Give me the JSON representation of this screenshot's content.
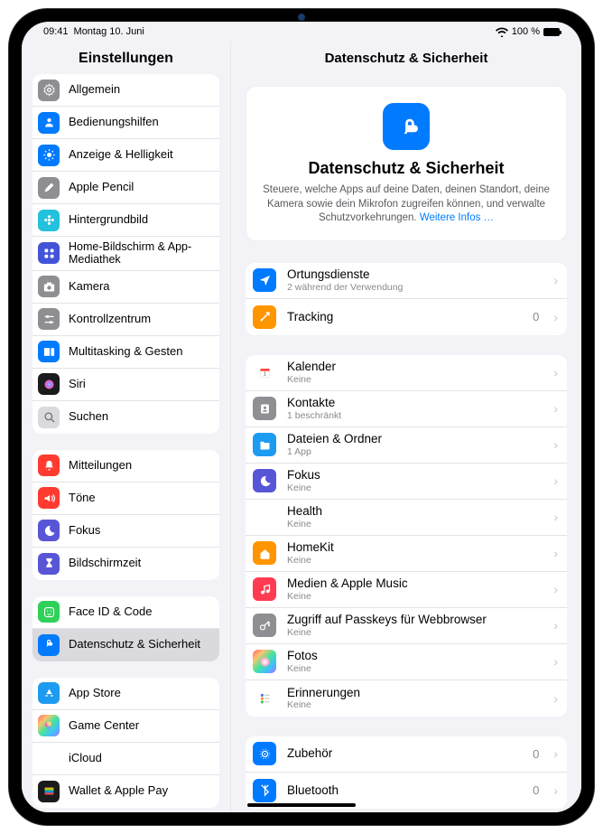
{
  "status": {
    "time": "09:41",
    "date": "Montag 10. Juni",
    "battery_text": "100 %"
  },
  "sidebar_title": "Einstellungen",
  "detail_title": "Datenschutz & Sicherheit",
  "hero": {
    "title": "Datenschutz & Sicherheit",
    "desc_prefix": "Steuere, welche Apps auf deine Daten, deinen Standort, deine Kamera sowie dein Mikrofon zugreifen können, und verwalte Schutzvorkehrungen. ",
    "link": "Weitere Infos …"
  },
  "sidebar_groups": [
    [
      {
        "id": "general",
        "label": "Allgemein",
        "icon": "gear",
        "bg": "#8e8e93"
      },
      {
        "id": "accessibility",
        "label": "Bedienungshilfen",
        "icon": "person",
        "bg": "#007aff"
      },
      {
        "id": "display",
        "label": "Anzeige & Helligkeit",
        "icon": "sun",
        "bg": "#007aff"
      },
      {
        "id": "pencil",
        "label": "Apple Pencil",
        "icon": "pencil",
        "bg": "#8e8e93"
      },
      {
        "id": "wallpaper",
        "label": "Hintergrundbild",
        "icon": "flower",
        "bg": "#23c1de"
      },
      {
        "id": "home",
        "label": "Home-Bildschirm & App-Mediathek",
        "icon": "grid",
        "bg": "#4353d8",
        "multiline": true
      },
      {
        "id": "camera",
        "label": "Kamera",
        "icon": "camera",
        "bg": "#8e8e93"
      },
      {
        "id": "control",
        "label": "Kontrollzentrum",
        "icon": "sliders",
        "bg": "#8e8e93"
      },
      {
        "id": "multitask",
        "label": "Multitasking & Gesten",
        "icon": "rects",
        "bg": "#007aff"
      },
      {
        "id": "siri",
        "label": "Siri",
        "icon": "siri",
        "bg": "#1b1b1d"
      },
      {
        "id": "search",
        "label": "Suchen",
        "icon": "search",
        "bg": "#d9d9de",
        "fg": "#6e6e73"
      }
    ],
    [
      {
        "id": "notifications",
        "label": "Mitteilungen",
        "icon": "bell",
        "bg": "#ff3b30"
      },
      {
        "id": "sounds",
        "label": "Töne",
        "icon": "speaker",
        "bg": "#ff3b30"
      },
      {
        "id": "focus",
        "label": "Fokus",
        "icon": "moon",
        "bg": "#5856d6"
      },
      {
        "id": "screentime",
        "label": "Bildschirmzeit",
        "icon": "hourglass",
        "bg": "#5856d6"
      }
    ],
    [
      {
        "id": "faceid",
        "label": "Face ID & Code",
        "icon": "face",
        "bg": "#30d158"
      },
      {
        "id": "privacy",
        "label": "Datenschutz & Sicherheit",
        "icon": "hand",
        "bg": "#007aff",
        "selected": true
      }
    ],
    [
      {
        "id": "appstore",
        "label": "App Store",
        "icon": "appstore",
        "bg": "#1d9bf0"
      },
      {
        "id": "gamecenter",
        "label": "Game Center",
        "icon": "gamecenter",
        "bg": "#ffffff",
        "grad": true
      },
      {
        "id": "icloud",
        "label": "iCloud",
        "icon": "cloud",
        "bg": "#ffffff",
        "fg": "#1fa8ff"
      },
      {
        "id": "wallet",
        "label": "Wallet & Apple Pay",
        "icon": "wallet",
        "bg": "#1b1b1d"
      }
    ]
  ],
  "detail_groups": [
    [
      {
        "id": "location",
        "label": "Ortungsdienste",
        "sub": "2 während der Verwendung",
        "icon": "location",
        "bg": "#007aff"
      },
      {
        "id": "tracking",
        "label": "Tracking",
        "value": "0",
        "icon": "tracking",
        "bg": "#ff9500"
      }
    ],
    [
      {
        "id": "calendar",
        "label": "Kalender",
        "sub": "Keine",
        "icon": "calendar",
        "bg": "#ffffff",
        "fg": "#ff3b30"
      },
      {
        "id": "contacts",
        "label": "Kontakte",
        "sub": "1 beschränkt",
        "icon": "contacts",
        "bg": "#8e8e93"
      },
      {
        "id": "files",
        "label": "Dateien & Ordner",
        "sub": "1 App",
        "icon": "folder",
        "bg": "#1d9bf0"
      },
      {
        "id": "focus2",
        "label": "Fokus",
        "sub": "Keine",
        "icon": "moon",
        "bg": "#5856d6"
      },
      {
        "id": "health",
        "label": "Health",
        "sub": "Keine",
        "icon": "heart",
        "bg": "#ffffff",
        "fg": "#ff3b5c"
      },
      {
        "id": "homekit",
        "label": "HomeKit",
        "sub": "Keine",
        "icon": "home",
        "bg": "#ff9500"
      },
      {
        "id": "media",
        "label": "Medien & Apple Music",
        "sub": "Keine",
        "icon": "music",
        "bg": "#ff3b52"
      },
      {
        "id": "passkeys",
        "label": "Zugriff auf Passkeys für Webbrowser",
        "sub": "Keine",
        "icon": "key",
        "bg": "#8e8e93"
      },
      {
        "id": "photos",
        "label": "Fotos",
        "sub": "Keine",
        "icon": "photos",
        "bg": "#ffffff",
        "grad": true
      },
      {
        "id": "reminders",
        "label": "Erinnerungen",
        "sub": "Keine",
        "icon": "reminders",
        "bg": "#ffffff",
        "fg": "#3478f6"
      }
    ],
    [
      {
        "id": "accessory",
        "label": "Zubehör",
        "value": "0",
        "icon": "accessory",
        "bg": "#007aff"
      },
      {
        "id": "bluetooth",
        "label": "Bluetooth",
        "value": "0",
        "icon": "bluetooth",
        "bg": "#007aff"
      }
    ]
  ]
}
